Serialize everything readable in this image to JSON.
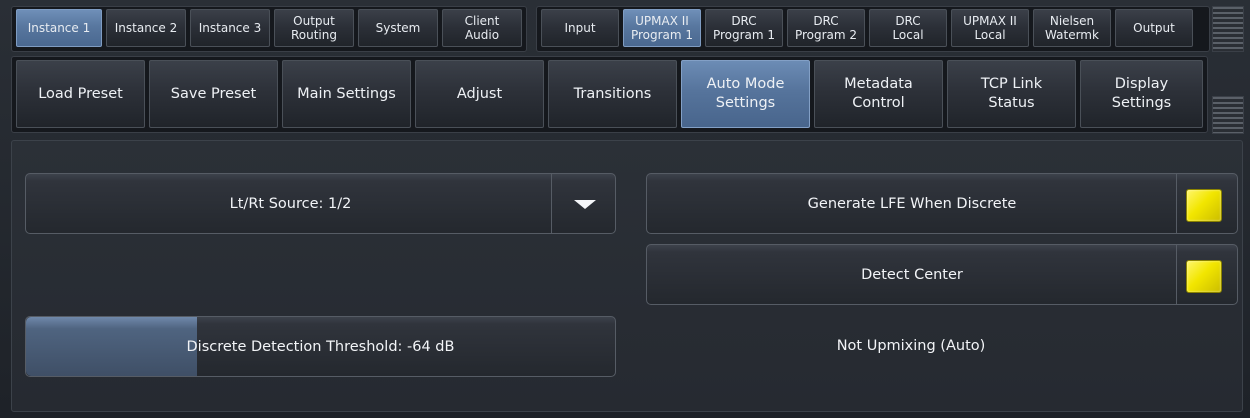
{
  "top_tabs": {
    "group1": [
      {
        "label": "Instance 1",
        "active": true
      },
      {
        "label": "Instance 2",
        "active": false
      },
      {
        "label": "Instance 3",
        "active": false
      },
      {
        "label": "Output\nRouting",
        "active": false
      },
      {
        "label": "System",
        "active": false
      },
      {
        "label": "Client\nAudio",
        "active": false
      }
    ],
    "group2": [
      {
        "label": "Input",
        "active": false
      },
      {
        "label": "UPMAX II\nProgram 1",
        "active": true
      },
      {
        "label": "DRC\nProgram 1",
        "active": false
      },
      {
        "label": "DRC\nProgram 2",
        "active": false
      },
      {
        "label": "DRC\nLocal",
        "active": false
      },
      {
        "label": "UPMAX II\nLocal",
        "active": false
      },
      {
        "label": "Nielsen\nWatermk",
        "active": false
      },
      {
        "label": "Output",
        "active": false
      }
    ]
  },
  "sub_tabs": [
    {
      "label": "Load Preset",
      "active": false
    },
    {
      "label": "Save Preset",
      "active": false
    },
    {
      "label": "Main Settings",
      "active": false
    },
    {
      "label": "Adjust",
      "active": false
    },
    {
      "label": "Transitions",
      "active": false
    },
    {
      "label": "Auto Mode\nSettings",
      "active": true
    },
    {
      "label": "Metadata\nControl",
      "active": false
    },
    {
      "label": "TCP Link\nStatus",
      "active": false
    },
    {
      "label": "Display\nSettings",
      "active": false
    }
  ],
  "panel": {
    "ltrt_source": {
      "label": "Lt/Rt Source: 1/2",
      "icon": "triangle-down-icon"
    },
    "generate_lfe": {
      "label": "Generate LFE When Discrete",
      "state": true,
      "indicator_color": "#f2e600"
    },
    "detect_center": {
      "label": "Detect Center",
      "state": true,
      "indicator_color": "#f2e600"
    },
    "threshold": {
      "label": "Discrete Detection Threshold: -64 dB",
      "level_fraction": 0.29
    },
    "status": "Not Upmixing (Auto)"
  },
  "colors": {
    "active_tab": "#58779f",
    "indicator_on": "#f2e600",
    "background": "#23272d"
  }
}
